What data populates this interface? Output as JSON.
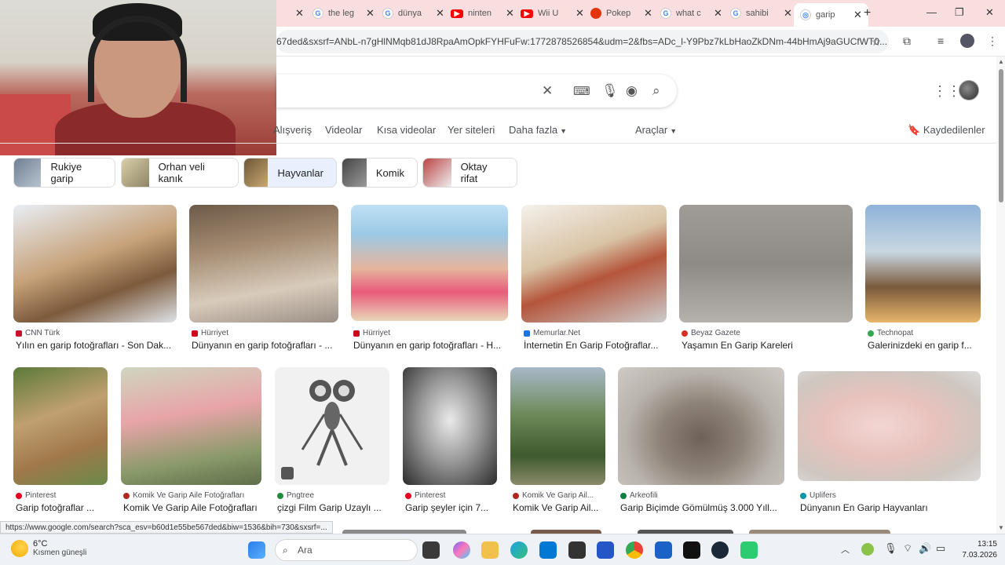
{
  "browser": {
    "tabs": [
      {
        "title": "",
        "icon": "globe-icon"
      },
      {
        "title": "the leg",
        "icon": "google-icon"
      },
      {
        "title": "dünya",
        "icon": "google-icon"
      },
      {
        "title": "ninten",
        "icon": "youtube-icon"
      },
      {
        "title": "Wii U",
        "icon": "youtube-icon"
      },
      {
        "title": "Pokep",
        "icon": "pokeball-icon"
      },
      {
        "title": "what c",
        "icon": "google-icon"
      },
      {
        "title": "sahibi",
        "icon": "google-icon"
      },
      {
        "title": "garip",
        "icon": "google-lens-icon",
        "active": true
      }
    ],
    "url": "67ded&sxsrf=ANbL-n7gHlNMqb81dJ8RpaAmOpkFYHFuFw:1772878526854&udm=2&fbs=ADc_l-Y9Pbz7kLbHaoZkDNm-44bHmAj9aGUCfWT0..."
  },
  "search": {
    "nav_tabs": [
      "Alışveriş",
      "Videolar",
      "Kısa videolar",
      "Yer siteleri",
      "Daha fazla",
      "Araçlar"
    ],
    "saved": "Kaydedilenler",
    "chips": [
      {
        "label": "Rukiye garip"
      },
      {
        "label": "Orhan veli kanık"
      },
      {
        "label": "Hayvanlar"
      },
      {
        "label": "Komik"
      },
      {
        "label": "Oktay rifat"
      }
    ]
  },
  "results_row1": [
    {
      "source": "CNN Türk",
      "title": "Yılın en garip fotoğrafları - Son Dak...",
      "color": "#c8102e"
    },
    {
      "source": "Hürriyet",
      "title": "Dünyanın en garip fotoğrafları - ...",
      "color": "#d0021b"
    },
    {
      "source": "Hürriyet",
      "title": "Dünyanın en garip fotoğrafları - H...",
      "color": "#d0021b"
    },
    {
      "source": "Memurlar.Net",
      "title": "İnternetin En Garip Fotoğraflar...",
      "color": "#1a73e8"
    },
    {
      "source": "Beyaz Gazete",
      "title": "Yaşamın En Garip Kareleri",
      "color": "#d93025"
    },
    {
      "source": "Technopat",
      "title": "Galerinizdeki en garip f...",
      "color": "#34a853"
    }
  ],
  "results_row2": [
    {
      "source": "Pinterest",
      "title": "Garip fotoğraflar ...",
      "color": "#e60023"
    },
    {
      "source": "Komik Ve Garip Aile Fotoğrafları",
      "title": "Komik Ve Garip Aile Fotoğrafları",
      "color": "#b3261e"
    },
    {
      "source": "Pngtree",
      "title": "çizgi Film Garip Uzaylı ...",
      "color": "#1e8e3e"
    },
    {
      "source": "Pinterest",
      "title": "Garip şeyler için 7...",
      "color": "#e60023"
    },
    {
      "source": "Komik Ve Garip Ail...",
      "title": "Komik Ve Garip Ail...",
      "color": "#b3261e"
    },
    {
      "source": "Arkeofili",
      "title": "Garip Biçimde Gömülmüş 3.000 Yıll...",
      "color": "#0b8043"
    },
    {
      "source": "Uplifers",
      "title": "Dünyanın En Garip Hayvanları",
      "color": "#0097a7"
    }
  ],
  "status_url": "https://www.google.com/search?sca_esv=b60d1e55be567ded&biw=1536&bih=730&sxsrf=...",
  "taskbar": {
    "temp": "6°C",
    "weather": "Kısmen güneşli",
    "search_placeholder": "Ara",
    "time": "13:15",
    "date": "7.03.2026"
  }
}
